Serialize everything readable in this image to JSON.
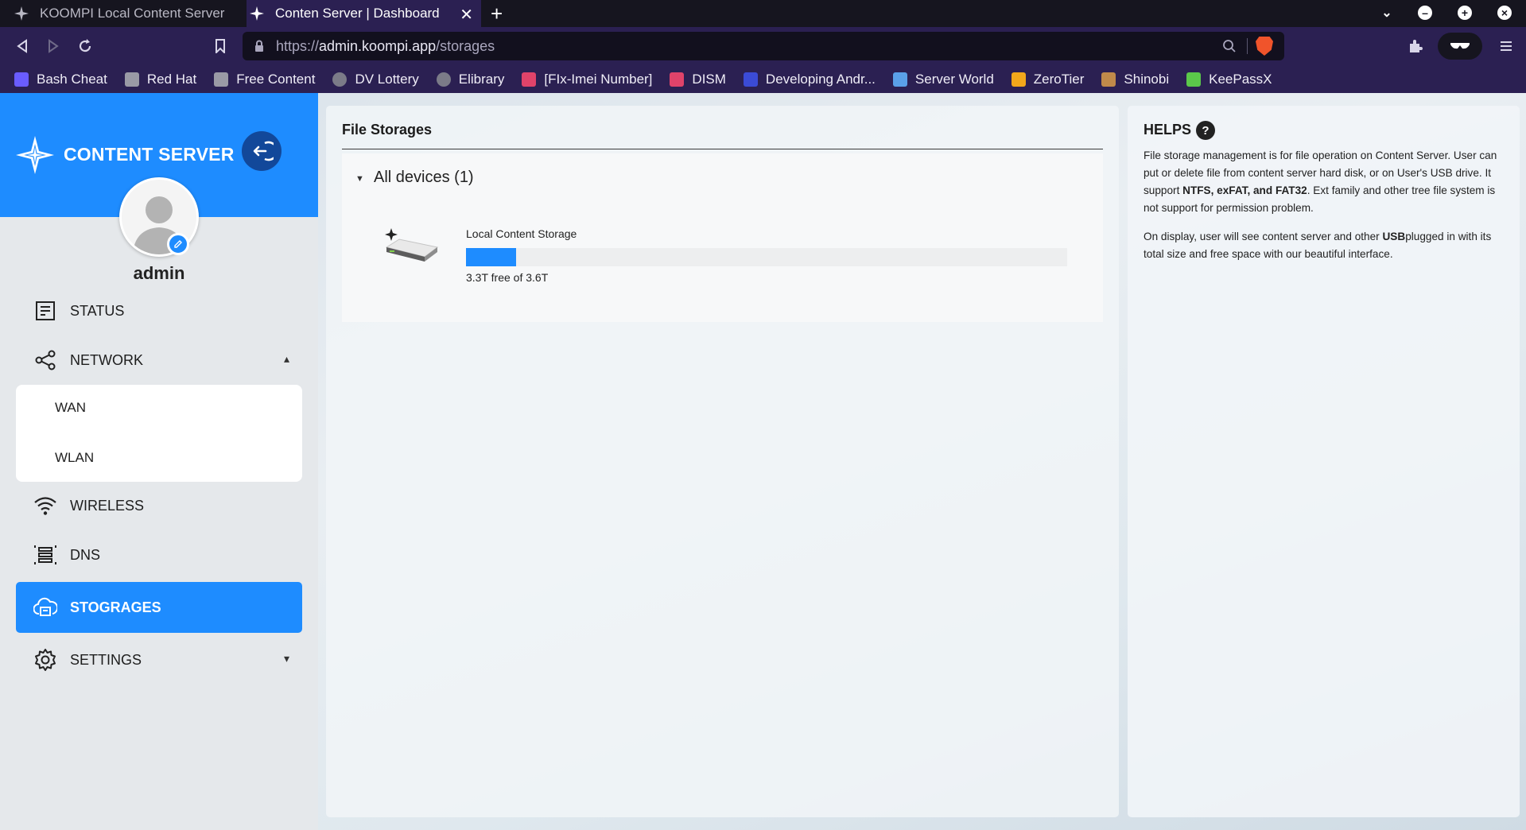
{
  "browser": {
    "tabs": [
      {
        "title": "KOOMPI Local Content Server"
      },
      {
        "title": "Conten Server | Dashboard"
      }
    ],
    "url": {
      "scheme": "https://",
      "host": "admin.koompi.app",
      "path": "/storages"
    },
    "bookmarks": [
      {
        "label": "Bash Cheat",
        "color": "#6a5cff"
      },
      {
        "label": "Red Hat",
        "color": "#9a9aa6"
      },
      {
        "label": "Free Content",
        "color": "#9a9aa6"
      },
      {
        "label": "DV Lottery",
        "color": "#7b7b88"
      },
      {
        "label": "Elibrary",
        "color": "#7b7b88"
      },
      {
        "label": "[FIx-Imei Number]",
        "color": "#e0436a"
      },
      {
        "label": "DISM",
        "color": "#e0436a"
      },
      {
        "label": "Developing Andr...",
        "color": "#3b4bd6"
      },
      {
        "label": "Server World",
        "color": "#5aa0e8"
      },
      {
        "label": "ZeroTier",
        "color": "#f2a71b"
      },
      {
        "label": "Shinobi",
        "color": "#c08a4a"
      },
      {
        "label": "KeePassX",
        "color": "#5bc84a"
      }
    ]
  },
  "sidebar": {
    "brand": "CONTENT SERVER",
    "username": "admin",
    "nav": {
      "status": "STATUS",
      "network": "NETWORK",
      "network_sub": [
        "WAN",
        "WLAN"
      ],
      "wireless": "WIRELESS",
      "dns": "DNS",
      "storages": "STOGRAGES",
      "settings": "SETTINGS"
    }
  },
  "main": {
    "title": "File Storages",
    "group_label": "All devices (1)",
    "storage": {
      "name": "Local Content Storage",
      "free_text": "3.3T free of 3.6T",
      "used_fraction": 0.083
    }
  },
  "help": {
    "title": "HELPS",
    "question_mark": "?",
    "p1_a": "File storage management is for file operation on Content Server. User can put or delete file from content server hard disk, or on User's USB drive. It support ",
    "p1_b": "NTFS, exFAT, and FAT32",
    "p1_c": ". Ext family and other tree file system is not support for permission problem.",
    "p2_a": "On display, user will see content server and other ",
    "p2_b": "USB",
    "p2_c": "plugged in with its total size and free space with our beautiful interface."
  },
  "colors": {
    "accent": "#1e8cff",
    "brave": "#f0542b"
  }
}
